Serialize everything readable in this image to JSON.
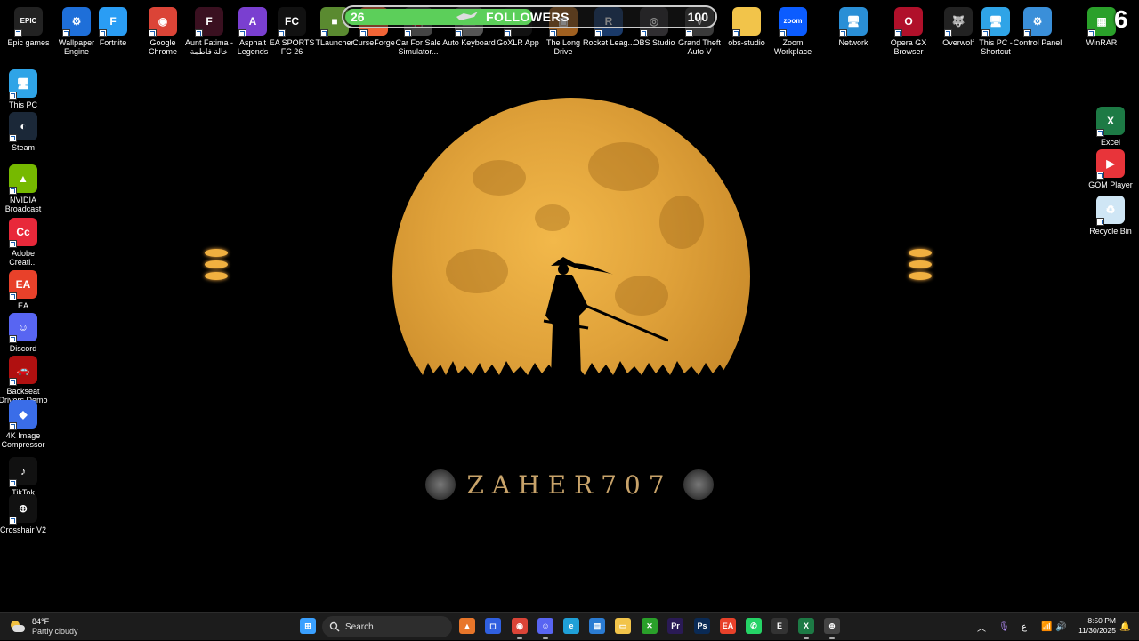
{
  "desktop": {
    "top_icons": [
      {
        "label": "Epic games",
        "icon": "epic-games-icon",
        "color": "#222222",
        "glyph": "EPIC"
      },
      {
        "label": "Wallpaper Engine",
        "icon": "wallpaper-engine-icon",
        "color": "#1e6fd9",
        "glyph": "⚙"
      },
      {
        "label": "Fortnite",
        "icon": "fortnite-icon",
        "color": "#2a9df4",
        "glyph": "F"
      },
      {
        "label": "Google Chrome",
        "icon": "chrome-icon",
        "color": "#db4437",
        "glyph": "◉"
      },
      {
        "label": "Aunt Fatima - خالة فاطمة",
        "icon": "aunt-fatima-icon",
        "color": "#3a1020",
        "glyph": "F"
      },
      {
        "label": "Asphalt Legends",
        "icon": "asphalt-icon",
        "color": "#7a3fd0",
        "glyph": "A"
      },
      {
        "label": "EA SPORTS FC 26",
        "icon": "ea-fc-icon",
        "color": "#111111",
        "glyph": "FC"
      },
      {
        "label": "TLauncher",
        "icon": "tlauncher-icon",
        "color": "#5a8a30",
        "glyph": "■"
      },
      {
        "label": "CurseForge",
        "icon": "curseforge-icon",
        "color": "#f16436",
        "glyph": "C"
      },
      {
        "label": "Car For Sale Simulator...",
        "icon": "car-for-sale-icon",
        "color": "#444444",
        "glyph": "🚗"
      },
      {
        "label": "Auto Keyboard",
        "icon": "auto-keyboard-icon",
        "color": "#555555",
        "glyph": "⌨"
      },
      {
        "label": "GoXLR App",
        "icon": "goxlr-icon",
        "color": "#111111",
        "glyph": "X"
      },
      {
        "label": "The Long Drive",
        "icon": "long-drive-icon",
        "color": "#a06020",
        "glyph": "▣"
      },
      {
        "label": "Rocket Leag...",
        "icon": "rocket-league-icon",
        "color": "#1a3a6a",
        "glyph": "R"
      },
      {
        "label": "OBS Studio",
        "icon": "obs-icon",
        "color": "#302e31",
        "glyph": "◎"
      },
      {
        "label": "Grand Theft Auto V",
        "icon": "gta-icon",
        "color": "#3a3a3a",
        "glyph": "V"
      },
      {
        "label": "obs-studio",
        "icon": "folder-icon",
        "color": "#f2c44a",
        "glyph": ""
      },
      {
        "label": "Zoom Workplace",
        "icon": "zoom-icon",
        "color": "#0b5cff",
        "glyph": "zoom"
      },
      {
        "label": "Network",
        "icon": "network-icon",
        "color": "#2a8fd6",
        "glyph": "🖥"
      },
      {
        "label": "Opera GX Browser",
        "icon": "opera-gx-icon",
        "color": "#b0102a",
        "glyph": "O"
      },
      {
        "label": "Overwolf",
        "icon": "overwolf-icon",
        "color": "#222222",
        "glyph": "🐺"
      },
      {
        "label": "This PC - Shortcut",
        "icon": "this-pc-shortcut-icon",
        "color": "#2fa4e7",
        "glyph": "🖥"
      },
      {
        "label": "Control Panel",
        "icon": "control-panel-icon",
        "color": "#3a8fd9",
        "glyph": "⚙"
      },
      {
        "label": "WinRAR",
        "icon": "winrar-icon",
        "color": "#2aa02a",
        "glyph": "▦"
      }
    ],
    "left_icons": [
      {
        "label": "This PC",
        "icon": "this-pc-icon",
        "color": "#2fa4e7",
        "glyph": "🖥"
      },
      {
        "label": "Steam",
        "icon": "steam-icon",
        "color": "#1b2838",
        "glyph": "◐"
      },
      {
        "label": "NVIDIA Broadcast",
        "icon": "nvidia-broadcast-icon",
        "color": "#76b900",
        "glyph": "▲"
      },
      {
        "label": "Adobe Creati...",
        "icon": "adobe-cc-icon",
        "color": "#e8283a",
        "glyph": "Cc"
      },
      {
        "label": "EA",
        "icon": "ea-icon",
        "color": "#e8412a",
        "glyph": "EA"
      },
      {
        "label": "Discord",
        "icon": "discord-icon",
        "color": "#5865f2",
        "glyph": "☺"
      },
      {
        "label": "Backseat Drivers Demo",
        "icon": "backseat-drivers-icon",
        "color": "#b01010",
        "glyph": "🚗"
      },
      {
        "label": "4K Image Compressor",
        "icon": "image-compressor-icon",
        "color": "#3a6de8",
        "glyph": "◆"
      },
      {
        "label": "TikTok",
        "icon": "tiktok-icon",
        "color": "#111111",
        "glyph": "♪"
      },
      {
        "label": "Crosshair V2",
        "icon": "crosshair-icon",
        "color": "#111111",
        "glyph": "⊕"
      }
    ],
    "right_icons": [
      {
        "label": "Excel",
        "icon": "excel-icon",
        "color": "#1d7a45",
        "glyph": "X"
      },
      {
        "label": "GOM Player",
        "icon": "gom-player-icon",
        "color": "#e8343a",
        "glyph": "▶"
      },
      {
        "label": "Recycle Bin",
        "icon": "recycle-bin-icon",
        "color": "#cfe6f5",
        "glyph": "♻"
      }
    ]
  },
  "overlay": {
    "followers_current": "26",
    "followers_title": "FOLLOWERS",
    "followers_goal": "100",
    "followers_progress": 0.26,
    "fill_color": "#5ccf5a",
    "corner_number": "6"
  },
  "wallpaper": {
    "brand_text": "ZAHER707",
    "moon_color": "#e8a83e"
  },
  "taskbar": {
    "weather_temp": "84°F",
    "weather_desc": "Partly cloudy",
    "search_placeholder": "Search",
    "apps": [
      {
        "name": "start-button",
        "icon": "windows-start-icon",
        "color": "#3aa0ff",
        "glyph": "⊞"
      },
      {
        "name": "taskbar-app-1",
        "icon": "orange-app-icon",
        "color": "#e8762a",
        "glyph": "▲"
      },
      {
        "name": "taskbar-app-2",
        "icon": "blue-app-icon",
        "color": "#3060e0",
        "glyph": "◻"
      },
      {
        "name": "taskbar-chrome",
        "icon": "chrome-icon",
        "color": "#db4437",
        "glyph": "◉"
      },
      {
        "name": "taskbar-discord",
        "icon": "discord-icon",
        "color": "#5865f2",
        "glyph": "☺"
      },
      {
        "name": "taskbar-edge",
        "icon": "edge-icon",
        "color": "#1fa0d8",
        "glyph": "e"
      },
      {
        "name": "taskbar-store",
        "icon": "store-icon",
        "color": "#2b7cd3",
        "glyph": "▤"
      },
      {
        "name": "taskbar-explorer",
        "icon": "file-explorer-icon",
        "color": "#f2c44a",
        "glyph": "▭"
      },
      {
        "name": "taskbar-xbox",
        "icon": "xbox-icon",
        "color": "#2aa02a",
        "glyph": "✕"
      },
      {
        "name": "taskbar-premiere",
        "icon": "premiere-icon",
        "color": "#2a1a55",
        "glyph": "Pr"
      },
      {
        "name": "taskbar-photoshop",
        "icon": "photoshop-icon",
        "color": "#0a2a55",
        "glyph": "Ps"
      },
      {
        "name": "taskbar-ea",
        "icon": "ea-icon",
        "color": "#e8412a",
        "glyph": "EA"
      },
      {
        "name": "taskbar-whatsapp",
        "icon": "whatsapp-icon",
        "color": "#25d366",
        "glyph": "✆"
      },
      {
        "name": "taskbar-epic",
        "icon": "epic-games-icon",
        "color": "#333333",
        "glyph": "E"
      },
      {
        "name": "taskbar-excel",
        "icon": "excel-icon",
        "color": "#1d7a45",
        "glyph": "X"
      },
      {
        "name": "taskbar-app-last",
        "icon": "crosshair-icon",
        "color": "#444444",
        "glyph": "⊕"
      }
    ],
    "tray_lang": "ع",
    "time": "8:50 PM",
    "date": "11/30/2025"
  }
}
